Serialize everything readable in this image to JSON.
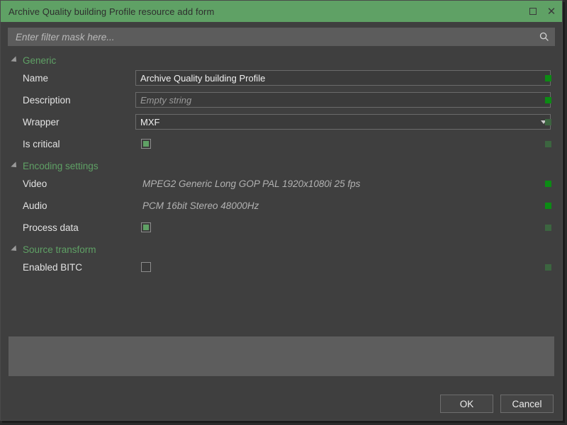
{
  "window": {
    "title": "Archive Quality building Profile resource add form",
    "controls": [
      {
        "name": "maximize",
        "icon": "maximize-icon"
      },
      {
        "name": "close",
        "icon": "close-icon"
      }
    ]
  },
  "filter": {
    "value": "",
    "placeholder": "Enter filter mask here...",
    "icon": "search-icon"
  },
  "form": {
    "rows": [
      {
        "kind": "group",
        "label": "Generic",
        "expanded": true
      },
      {
        "kind": "text",
        "label": "Name",
        "value": "Archive Quality building Profile",
        "placeholder": "",
        "status": "bright"
      },
      {
        "kind": "text",
        "label": "Description",
        "value": "",
        "placeholder": "Empty string",
        "status": "bright"
      },
      {
        "kind": "combo",
        "label": "Wrapper",
        "value": "MXF",
        "status": "dim"
      },
      {
        "kind": "check",
        "label": "Is critical",
        "checked": true,
        "status": "dim"
      },
      {
        "kind": "group",
        "label": "Encoding settings",
        "expanded": true
      },
      {
        "kind": "readonly",
        "label": "Video",
        "value": "MPEG2 Generic Long GOP PAL 1920x1080i 25 fps",
        "status": "bright"
      },
      {
        "kind": "readonly",
        "label": "Audio",
        "value": "PCM 16bit Stereo 48000Hz",
        "status": "bright"
      },
      {
        "kind": "check",
        "label": "Process data",
        "checked": true,
        "status": "dim"
      },
      {
        "kind": "group",
        "label": "Source transform",
        "expanded": true
      },
      {
        "kind": "check",
        "label": "Enabled BITC",
        "checked": false,
        "status": "dim"
      }
    ]
  },
  "footer": {
    "ok_label": "OK",
    "cancel_label": "Cancel"
  },
  "colors": {
    "accent_green": "#5fa165",
    "window_bg": "#3f3f3f",
    "panel_bg": "#5d5d5d",
    "status_bright": "#0c8b14",
    "status_dim": "#3c6540"
  }
}
